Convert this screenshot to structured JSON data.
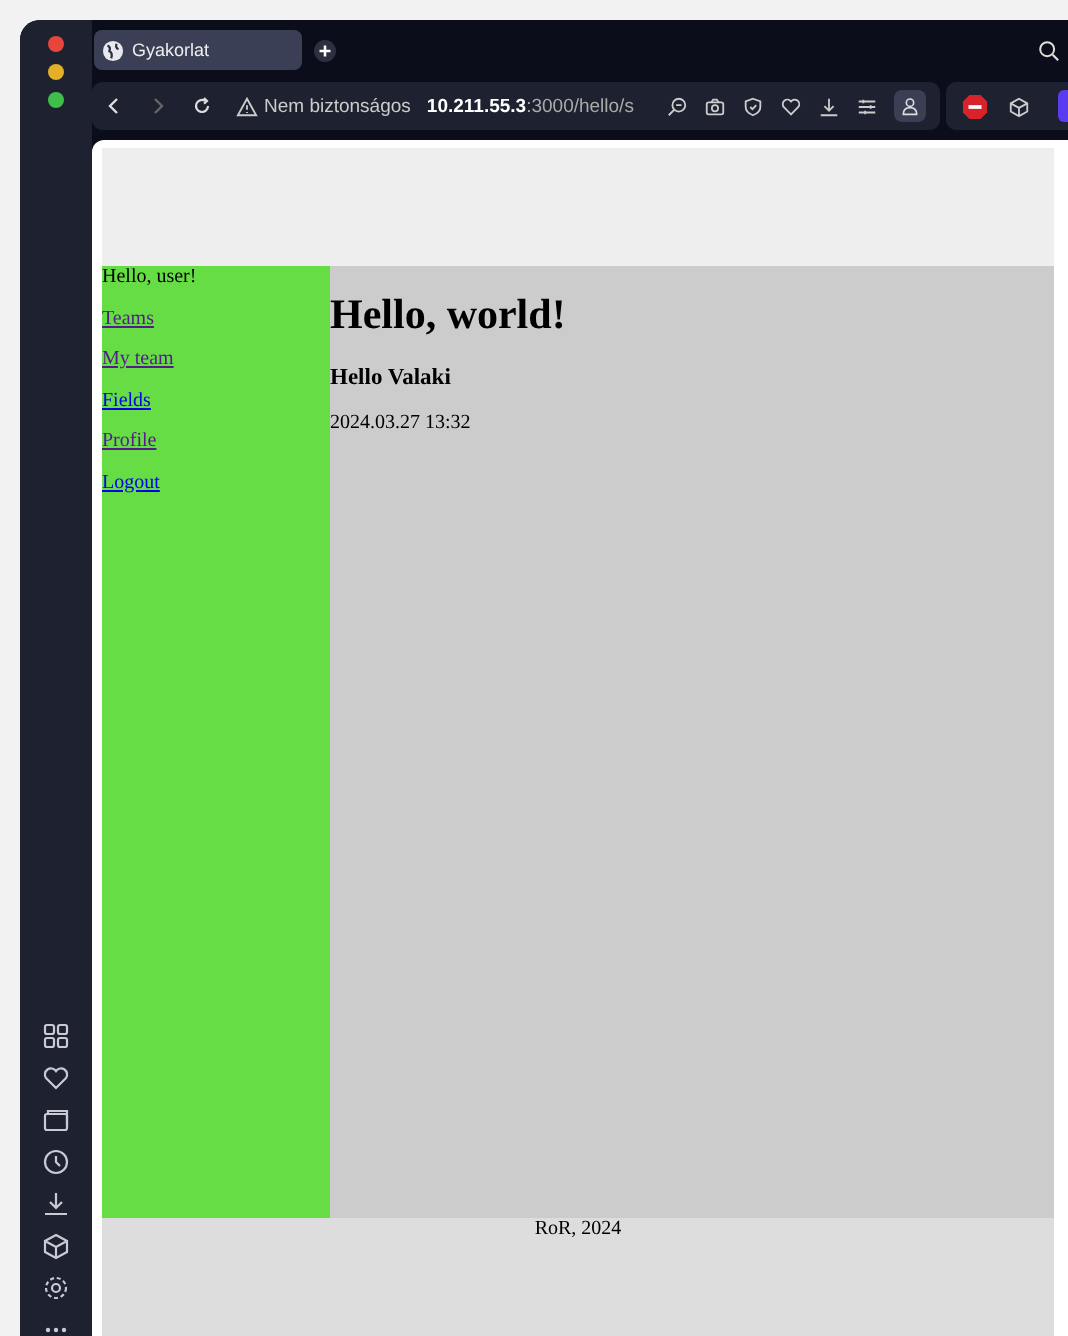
{
  "browser": {
    "tab": {
      "title": "Gyakorlat",
      "selected": true
    },
    "security_warning": "Nem biztonságos",
    "url": "**10.211.55.3**:3000/hello/s"
  },
  "page": {
    "greeting": "Hello, user!",
    "nav": [
      {
        "label": "Teams",
        "visited": true
      },
      {
        "label": "My team",
        "visited": true
      },
      {
        "label": "Fields",
        "visited": false
      },
      {
        "label": "Profile",
        "visited": true
      },
      {
        "label": "Logout",
        "visited": false
      }
    ],
    "title": "Hello, world!",
    "subtitle": "Hello Valaki",
    "timestamp": "2024.03.27 13:32",
    "footer": "RoR, 2024"
  }
}
